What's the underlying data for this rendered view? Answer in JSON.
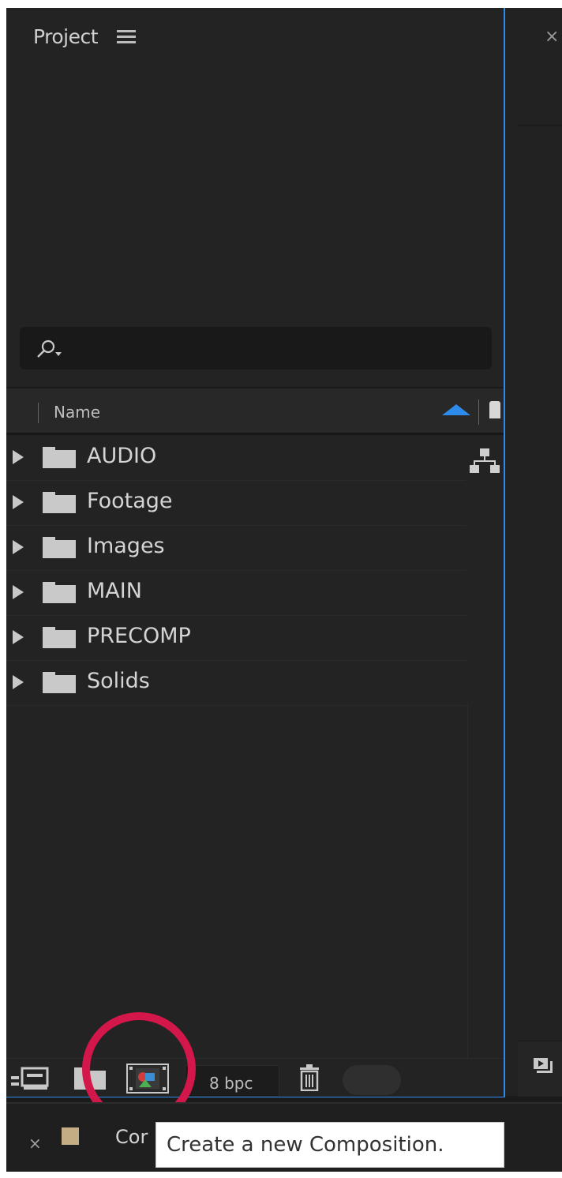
{
  "project_panel": {
    "title": "Project",
    "menu_icon": "hamburger-menu-icon",
    "search": {
      "icon": "search-dropdown-icon",
      "placeholder": ""
    },
    "columns": {
      "name_header": "Name",
      "sort": "ascending"
    },
    "items": [
      {
        "label": "AUDIO",
        "icon": "folder-icon"
      },
      {
        "label": "Footage",
        "icon": "folder-icon"
      },
      {
        "label": "Images",
        "icon": "folder-icon"
      },
      {
        "label": "MAIN",
        "icon": "folder-icon"
      },
      {
        "label": "PRECOMP",
        "icon": "folder-icon"
      },
      {
        "label": "Solids",
        "icon": "folder-icon"
      }
    ],
    "toolbar": {
      "bit_depth": "8 bpc",
      "icons": [
        "interpret-footage-icon",
        "new-folder-icon",
        "new-composition-icon",
        "trash-icon"
      ]
    }
  },
  "right_panel": {
    "close_glyph": "×"
  },
  "timeline_tab": {
    "close_glyph": "×",
    "label": "Cor",
    "swatch_color": "#c4ad84"
  },
  "tooltip": {
    "text": "Create a new Composition."
  },
  "colors": {
    "accent": "#2d8ceb",
    "highlight_circle": "#d4174a",
    "panel_bg": "#232323"
  }
}
